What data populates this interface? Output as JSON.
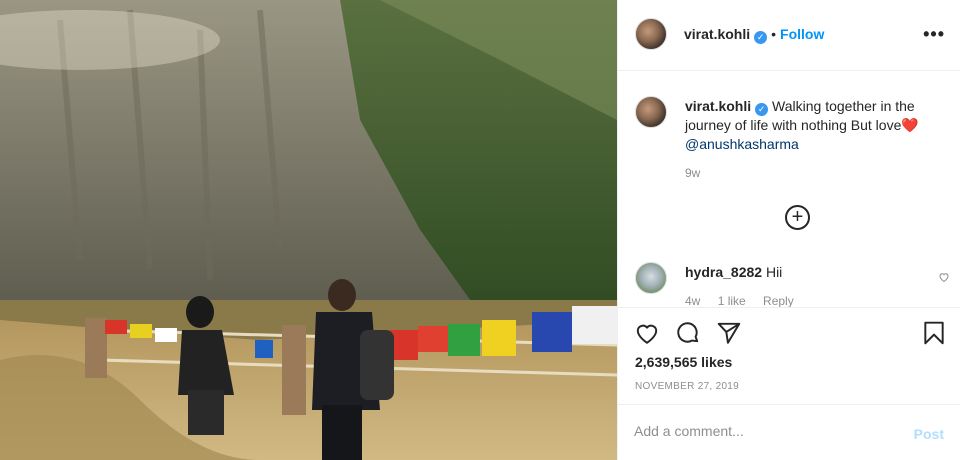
{
  "post": {
    "username": "virat.kohli",
    "follow_label": "Follow",
    "dot": "•",
    "more_label": "•••",
    "verified_mark": "✓"
  },
  "caption": {
    "username": "virat.kohli",
    "text": "Walking together in the journey of life with nothing But love",
    "emoji": "❤️",
    "mention": "@anushkasharma",
    "time_ago": "9w"
  },
  "load_more_label": "+",
  "comments": [
    {
      "username": "hydra_8282",
      "text": "Hii",
      "time_ago": "4w",
      "likes": "1 like",
      "reply_label": "Reply"
    }
  ],
  "likes_text": "2,639,565 likes",
  "date": "NOVEMBER 27, 2019",
  "add_comment": {
    "placeholder": "Add a comment...",
    "post_label": "Post"
  },
  "icons": [
    "heart-icon",
    "comment-icon",
    "share-icon",
    "bookmark-icon",
    "verified-icon",
    "more-icon",
    "plus-icon"
  ],
  "colors": {
    "link": "#0095f6",
    "mention": "#00376b",
    "muted": "#8e8e8e",
    "verified": "#3897f0",
    "post_disabled": "#b2dffc"
  }
}
